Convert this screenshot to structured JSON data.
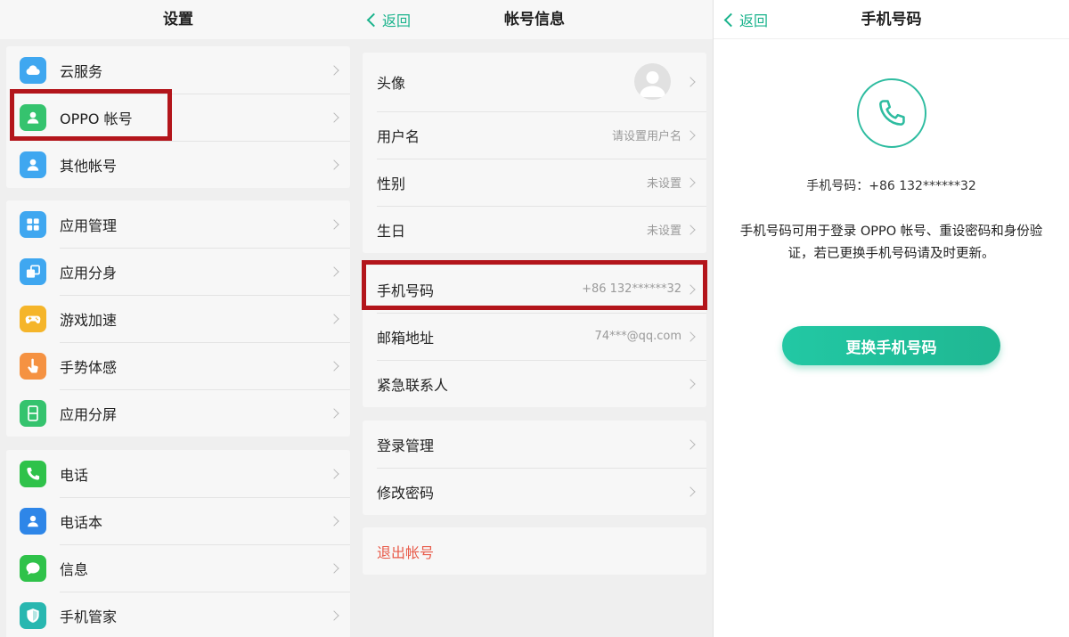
{
  "settings": {
    "title": "设置",
    "group1": [
      {
        "label": "云服务",
        "icon": "cloud-icon",
        "color": "#3fa7f0"
      },
      {
        "label": "OPPO 帐号",
        "icon": "user-icon",
        "color": "#35c36e"
      },
      {
        "label": "其他帐号",
        "icon": "user-icon",
        "color": "#3fa7f0"
      }
    ],
    "group2": [
      {
        "label": "应用管理",
        "icon": "grid-icon",
        "color": "#3fa7f0"
      },
      {
        "label": "应用分身",
        "icon": "clone-icon",
        "color": "#3fa7f0"
      },
      {
        "label": "游戏加速",
        "icon": "gamepad-icon",
        "color": "#f5b52a"
      },
      {
        "label": "手势体感",
        "icon": "gesture-icon",
        "color": "#f59242"
      },
      {
        "label": "应用分屏",
        "icon": "split-screen-icon",
        "color": "#35c36e"
      }
    ],
    "group3": [
      {
        "label": "电话",
        "icon": "phone-icon",
        "color": "#2fc24a"
      },
      {
        "label": "电话本",
        "icon": "contacts-icon",
        "color": "#2e86e8"
      },
      {
        "label": "信息",
        "icon": "message-icon",
        "color": "#2fc24a"
      },
      {
        "label": "手机管家",
        "icon": "shield-icon",
        "color": "#28b7b0"
      }
    ]
  },
  "account": {
    "back": "返回",
    "title": "帐号信息",
    "group1": [
      {
        "label": "头像",
        "value": ""
      },
      {
        "label": "用户名",
        "value": "请设置用户名"
      },
      {
        "label": "性别",
        "value": "未设置"
      },
      {
        "label": "生日",
        "value": "未设置"
      }
    ],
    "group2": [
      {
        "label": "手机号码",
        "value": "+86 132******32"
      },
      {
        "label": "邮箱地址",
        "value": "74***@qq.com"
      },
      {
        "label": "紧急联系人",
        "value": ""
      }
    ],
    "group3": [
      {
        "label": "登录管理"
      },
      {
        "label": "修改密码"
      }
    ],
    "logout": "退出帐号"
  },
  "phone": {
    "back": "返回",
    "title": "手机号码",
    "number_line": "手机号码：+86 132******32",
    "description": "手机号码可用于登录 OPPO 帐号、重设密码和身份验证，若已更换手机号码请及时更新。",
    "change_button": "更换手机号码"
  },
  "colors": {
    "accent": "#1ab38c",
    "highlight": "#b3151b",
    "danger": "#e85b4a"
  }
}
